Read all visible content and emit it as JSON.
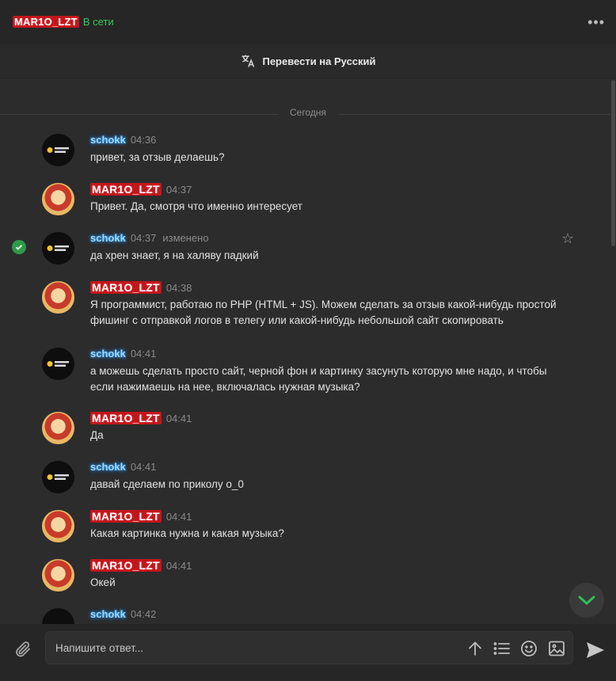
{
  "header": {
    "username": "MAR1O_LZT",
    "status": "В сети",
    "translate_label": "Перевести на Русский"
  },
  "chat": {
    "day_separator": "Сегодня",
    "messages": [
      {
        "author": "schokk",
        "time": "04:36",
        "text": "привет, за отзыв делаешь?"
      },
      {
        "author": "MAR1O_LZT",
        "time": "04:37",
        "text": "Привет. Да, смотря что именно интересует"
      },
      {
        "author": "schokk",
        "time": "04:37",
        "edited": "изменено",
        "text": "да хрен знает, я на халяву падкий"
      },
      {
        "author": "MAR1O_LZT",
        "time": "04:38",
        "text": "Я программист, работаю по PHP (HTML + JS). Можем сделать за отзыв какой-нибудь простой фишинг с отправкой логов в телегу или какой-нибудь небольшой сайт скопировать"
      },
      {
        "author": "schokk",
        "time": "04:41",
        "text": "а можешь сделать просто сайт, черной фон и картинку засунуть которую мне надо, и чтобы если нажимаешь на нее, включалась нужная музыка?"
      },
      {
        "author": "MAR1O_LZT",
        "time": "04:41",
        "text": "Да"
      },
      {
        "author": "schokk",
        "time": "04:41",
        "text": "давай сделаем по приколу о_0"
      },
      {
        "author": "MAR1O_LZT",
        "time": "04:41",
        "text": "Какая картинка нужна и какая музыка?"
      },
      {
        "author": "MAR1O_LZT",
        "time": "04:41",
        "text": "Окей"
      },
      {
        "author": "schokk",
        "time": "04:42",
        "text": ""
      }
    ]
  },
  "composer": {
    "placeholder": "Напишите ответ..."
  },
  "icons": {
    "more": "more-dots-icon",
    "translate": "translate-icon",
    "check": "check-circle-icon",
    "star": "star-icon",
    "scroll_down": "chevron-down-icon",
    "attach": "paperclip-icon",
    "arrow_up": "arrow-up-icon",
    "list": "list-icon",
    "emoji": "smile-icon",
    "image": "image-icon",
    "send": "send-icon"
  },
  "colors": {
    "background": "#2a2a2a",
    "online": "#3bc95b",
    "name_red_bg": "#c0171d",
    "name_blue": "#9bd8ff",
    "check_green": "#2e9a48",
    "scroll_down_green": "#2fbf5a"
  }
}
